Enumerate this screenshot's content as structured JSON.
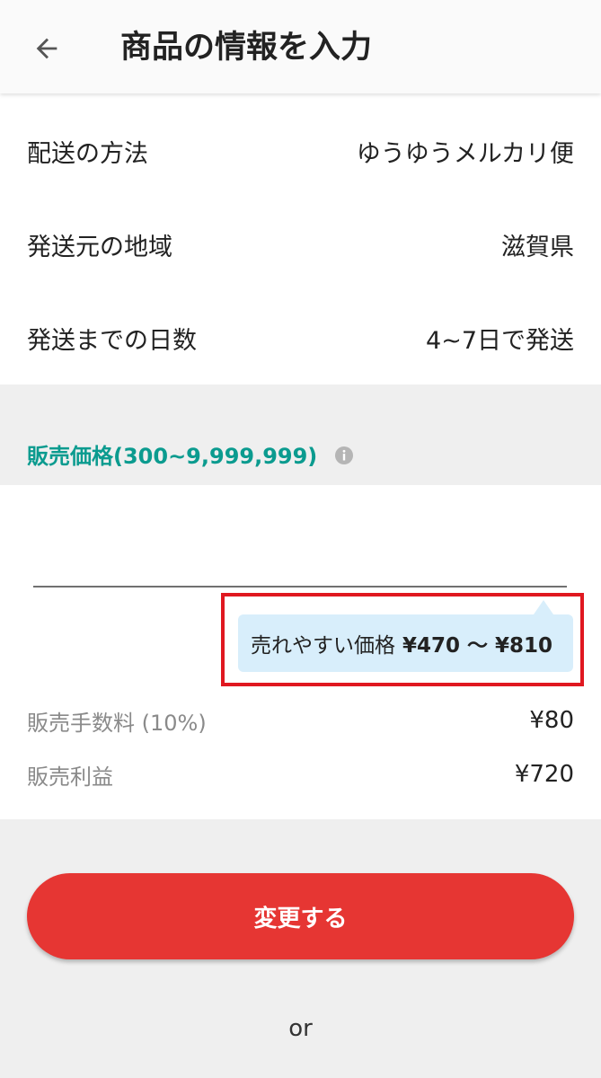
{
  "header": {
    "back_icon": "arrow-left-icon",
    "title": "商品の情報を入力"
  },
  "shipping": {
    "method_label": "配送の方法",
    "method_value": "ゆうゆうメルカリ便",
    "origin_label": "発送元の地域",
    "origin_value": "滋賀県",
    "days_label": "発送までの日数",
    "days_value": "4~7日で発送"
  },
  "price": {
    "label": "販売価格(300~9,999,999)",
    "info_icon": "info-icon",
    "input_value": "",
    "suggestion_text": "売れやすい価格",
    "suggestion_range": "¥470 〜 ¥810",
    "fee_label": "販売手数料 (10%)",
    "fee_value": "¥80",
    "profit_label": "販売利益",
    "profit_value": "¥720"
  },
  "actions": {
    "submit_label": "変更する",
    "or_text": "or"
  },
  "colors": {
    "accent_teal": "#0b9b8f",
    "button_red": "#e63633",
    "highlight_red": "#e01820",
    "tooltip_bg": "#d8eefb"
  }
}
